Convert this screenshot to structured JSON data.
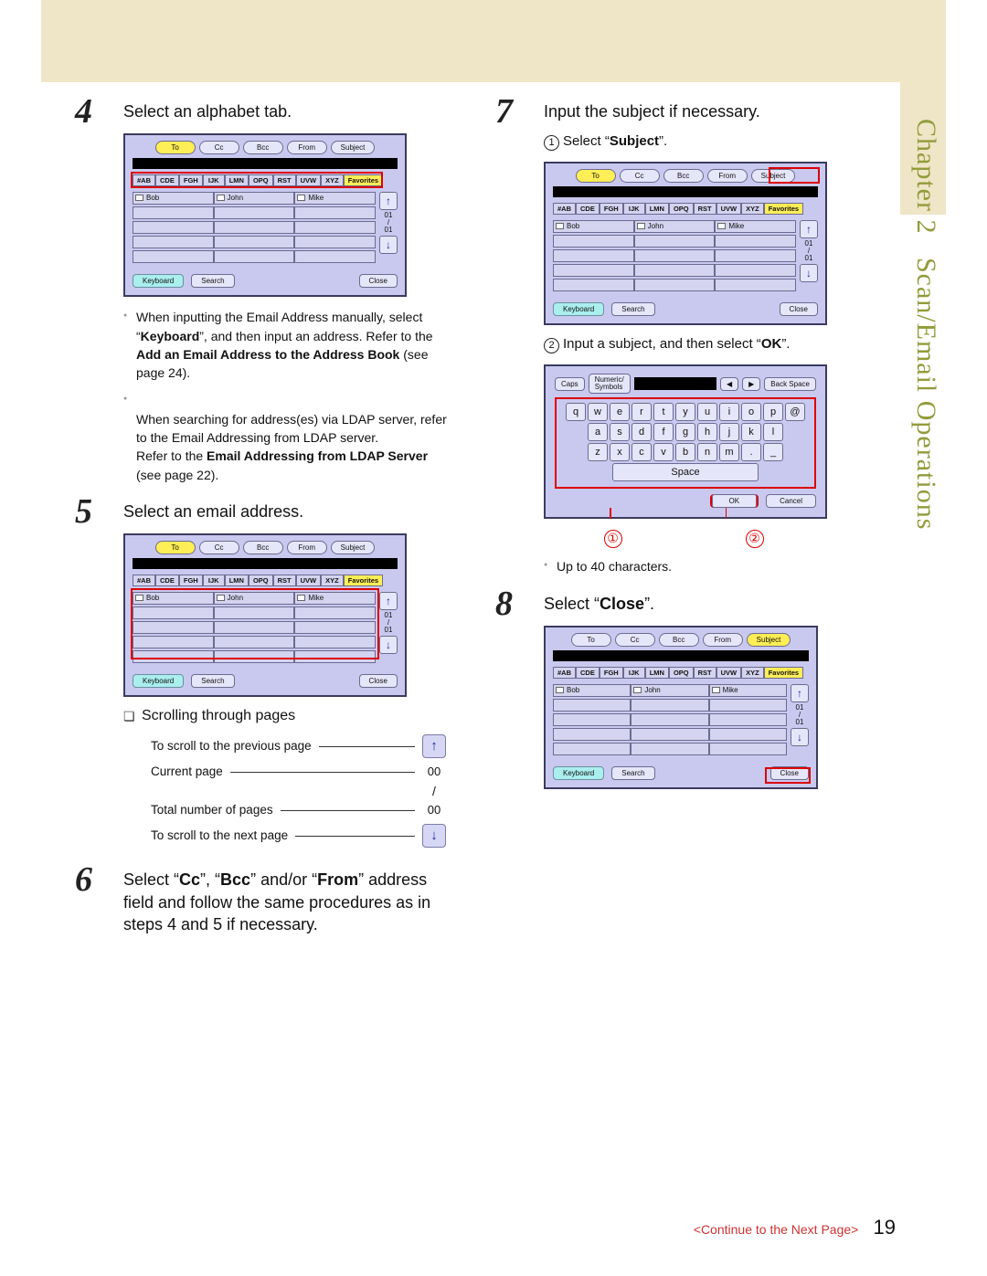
{
  "page": {
    "chapter_label": "Chapter 2",
    "chapter_title": "Scan/Email Operations",
    "continue_text": "<Continue to the Next Page>",
    "page_number": "19"
  },
  "steps": {
    "s4": {
      "num": "4",
      "title": "Select an alphabet tab.",
      "bullets": [
        {
          "pre": "When inputting the Email Address manually, select “",
          "b1": "Keyboard",
          "mid": "”, and then input an address. Refer to the ",
          "b2": "Add an Email Address to the Address Book",
          "post": " (see page 24)."
        },
        {
          "pre": "When searching for address(es) via LDAP server, refer to the Email Addressing from LDAP server.\nRefer to the ",
          "b1": "Email Addressing from LDAP Server",
          "post": " (see page 22)."
        }
      ]
    },
    "s5": {
      "num": "5",
      "title": "Select an email address.",
      "subhead": "Scrolling through pages",
      "legend": {
        "r1": "To scroll to the previous page",
        "r2": "Current page",
        "r2v": "00",
        "r3": "Total number of pages",
        "r3v": "00",
        "r4": "To scroll to the next page"
      }
    },
    "s6": {
      "num": "6",
      "text_parts": [
        "Select “",
        "Cc",
        "”, “",
        "Bcc",
        "” and/or “",
        "From",
        "” address field and follow the same procedures as in steps 4 and 5 if necessary."
      ]
    },
    "s7": {
      "num": "7",
      "title": "Input the subject if necessary.",
      "sub1": [
        "Select “",
        "Subject",
        "”."
      ],
      "sub2": [
        "Input a subject, and then select “",
        "OK",
        "”."
      ],
      "note": "Up to 40 characters.",
      "callouts": {
        "a": "①",
        "b": "②"
      }
    },
    "s8": {
      "num": "8",
      "text_parts": [
        "Select “",
        "Close",
        "”."
      ]
    }
  },
  "screenshot": {
    "top_tabs": [
      "To",
      "Cc",
      "Bcc",
      "From",
      "Subject"
    ],
    "alpha_tabs": [
      "#AB",
      "CDE",
      "FGH",
      "IJK",
      "LMN",
      "OPQ",
      "RST",
      "UVW",
      "XYZ",
      "Favorites"
    ],
    "names": [
      "Bob",
      "John",
      "Mike"
    ],
    "scroll": {
      "page": "01",
      "sep": "/",
      "total": "01"
    },
    "bottom": {
      "keyboard": "Keyboard",
      "search": "Search",
      "close": "Close"
    }
  },
  "keyboard": {
    "caps": "Caps",
    "numsym": "Numeric/\nSymbols",
    "back": "Back Space",
    "nav_left": "◀",
    "nav_right": "▶",
    "row1": [
      "q",
      "w",
      "e",
      "r",
      "t",
      "y",
      "u",
      "i",
      "o",
      "p",
      "@"
    ],
    "row2": [
      "a",
      "s",
      "d",
      "f",
      "g",
      "h",
      "j",
      "k",
      "l"
    ],
    "row3": [
      "z",
      "x",
      "c",
      "v",
      "b",
      "n",
      "m",
      ".",
      "_"
    ],
    "space": "Space",
    "ok": "OK",
    "cancel": "Cancel"
  }
}
